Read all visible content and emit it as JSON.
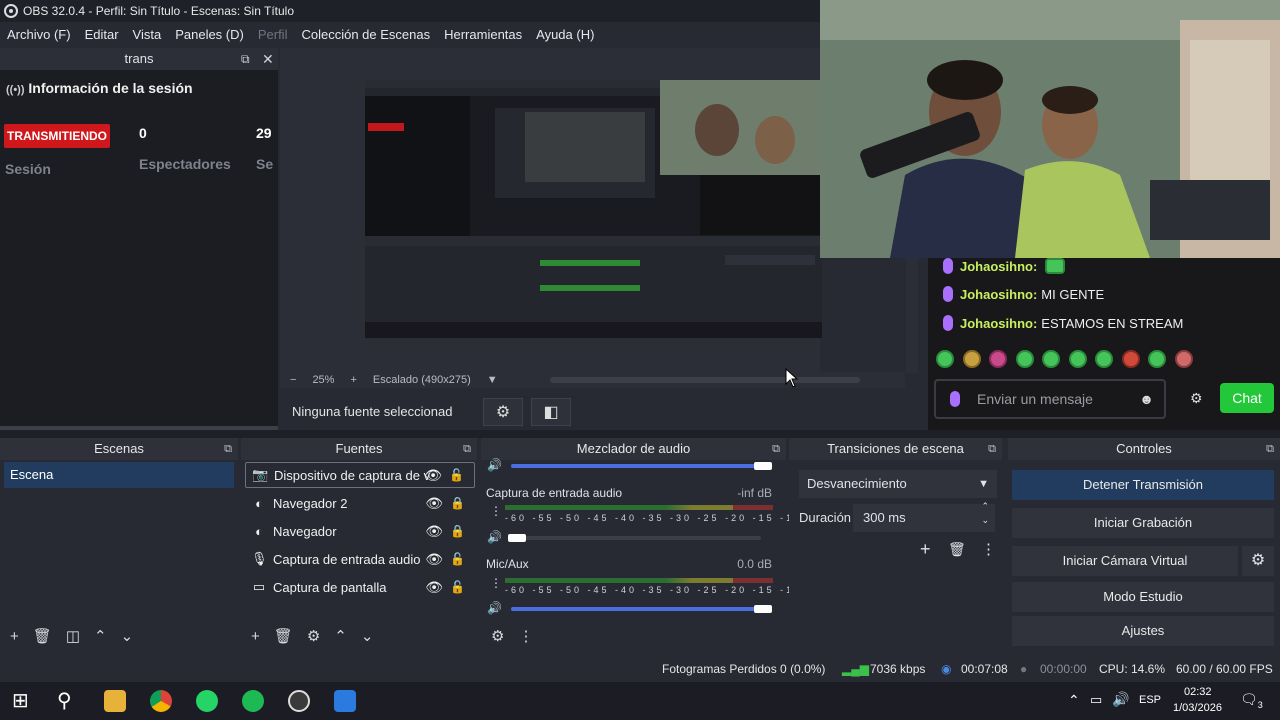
{
  "window": {
    "title": "OBS 32.0.4 - Perfil: Sin Título - Escenas: Sin Título"
  },
  "menu": [
    {
      "label": "Archivo (F)",
      "enabled": true
    },
    {
      "label": "Editar",
      "enabled": true
    },
    {
      "label": "Vista",
      "enabled": true
    },
    {
      "label": "Paneles (D)",
      "enabled": true
    },
    {
      "label": "Perfil",
      "enabled": false
    },
    {
      "label": "Colección de Escenas",
      "enabled": true
    },
    {
      "label": "Herramientas",
      "enabled": true
    },
    {
      "label": "Ayuda (H)",
      "enabled": true
    }
  ],
  "session_dock": {
    "title": "trans",
    "heading": "Información de la sesión",
    "status_badge": "TRANSMITIENDO",
    "session_label": "Sesión",
    "viewers_value": "0",
    "viewers_label": "Espectadores",
    "partial_value": "29",
    "partial_label": "Se"
  },
  "preview": {
    "zoom_minus": "−",
    "zoom": "25%",
    "zoom_plus": "+",
    "scale": "Escalado (490x275)"
  },
  "source_toolbar": {
    "no_source": "Ninguna fuente seleccionad"
  },
  "chat": {
    "messages": [
      {
        "user": "Johaosihno:",
        "text": ""
      },
      {
        "user": "Johaosihno:",
        "text": "MI GENTE"
      },
      {
        "user": "Johaosihno:",
        "text": "ESTAMOS EN STREAM"
      }
    ],
    "input_placeholder": "Enviar un mensaje",
    "send_label": "Chat"
  },
  "scenes": {
    "title": "Escenas",
    "items": [
      "Escena"
    ]
  },
  "sources": {
    "title": "Fuentes",
    "items": [
      {
        "label": "Dispositivo de captura de v",
        "icon": "camera-icon"
      },
      {
        "label": "Navegador 2",
        "icon": "globe-icon"
      },
      {
        "label": "Navegador",
        "icon": "globe-icon"
      },
      {
        "label": "Captura de entrada audio",
        "icon": "mic-icon"
      },
      {
        "label": "Captura de pantalla",
        "icon": "monitor-icon"
      }
    ]
  },
  "mixer": {
    "title": "Mezclador de audio",
    "channels": [
      {
        "name": "Captura de entrada audio",
        "db": "-inf dB",
        "volume": 0.05
      },
      {
        "name": "Mic/Aux",
        "db": "0.0 dB",
        "volume": 1.0
      }
    ],
    "scale": "-60 -55 -50 -45 -40 -35 -30 -25 -20 -15 -10 -5 0"
  },
  "transitions": {
    "title": "Transiciones de escena",
    "selected": "Desvanecimiento",
    "duration_label": "Duración",
    "duration_value": "300 ms"
  },
  "controls": {
    "title": "Controles",
    "buttons": [
      "Detener Transmisión",
      "Iniciar Grabación",
      "Iniciar Cámara Virtual",
      "Modo Estudio",
      "Ajustes"
    ]
  },
  "status": {
    "dropped": "Fotogramas Perdidos 0 (0.0%)",
    "bitrate": "7036 kbps",
    "stream_time": "00:07:08",
    "rec_time": "00:00:00",
    "cpu": "CPU: 14.6%",
    "fps": "60.00 / 60.00 FPS"
  },
  "taskbar": {
    "language": "ESP",
    "time": "02:32",
    "date": "1/03/2026",
    "notifications": "3"
  },
  "colors": {
    "live_badge": "#d0181c",
    "chat_button": "#22c73a",
    "selection": "#213c5e"
  }
}
